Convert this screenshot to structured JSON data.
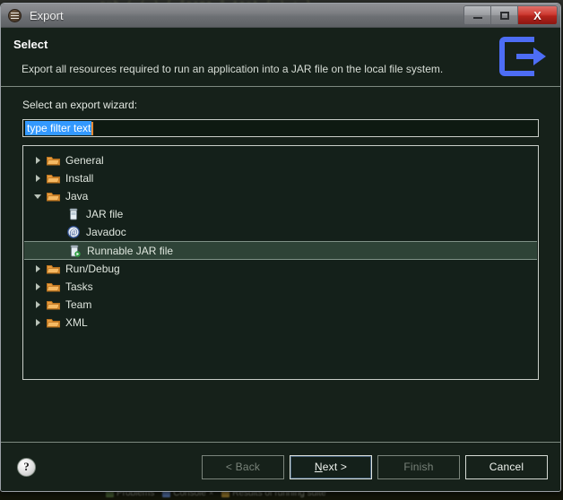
{
  "window": {
    "title": "Export",
    "icon": "eclipse-export-icon",
    "controls": {
      "minimize": "minimize-icon",
      "maximize": "maximize-icon",
      "close": "X"
    }
  },
  "header": {
    "title": "Select",
    "description": "Export all resources required to run an application into a JAR file on the local file system.",
    "icon": "export-arrow-icon",
    "icon_color": "#4d6df5"
  },
  "body": {
    "wizard_label": "Select an export wizard:",
    "filter": {
      "value": "type filter text",
      "placeholder": "type filter text",
      "selected": true
    },
    "tree": [
      {
        "label": "General",
        "depth": 0,
        "state": "collapsed",
        "icon": "folder-icon",
        "selected": false
      },
      {
        "label": "Install",
        "depth": 0,
        "state": "collapsed",
        "icon": "folder-icon",
        "selected": false
      },
      {
        "label": "Java",
        "depth": 0,
        "state": "expanded",
        "icon": "folder-icon",
        "selected": false
      },
      {
        "label": "JAR file",
        "depth": 1,
        "state": "leaf",
        "icon": "jar-file-icon",
        "selected": false
      },
      {
        "label": "Javadoc",
        "depth": 1,
        "state": "leaf",
        "icon": "javadoc-icon",
        "selected": false
      },
      {
        "label": "Runnable JAR file",
        "depth": 1,
        "state": "leaf",
        "icon": "runnable-jar-icon",
        "selected": true
      },
      {
        "label": "Run/Debug",
        "depth": 0,
        "state": "collapsed",
        "icon": "folder-icon",
        "selected": false
      },
      {
        "label": "Tasks",
        "depth": 0,
        "state": "collapsed",
        "icon": "folder-icon",
        "selected": false
      },
      {
        "label": "Team",
        "depth": 0,
        "state": "collapsed",
        "icon": "folder-icon",
        "selected": false
      },
      {
        "label": "XML",
        "depth": 0,
        "state": "collapsed",
        "icon": "folder-icon",
        "selected": false
      }
    ]
  },
  "footer": {
    "help_icon": "question-mark-icon",
    "help_glyph": "?",
    "buttons": [
      {
        "label": "< Back",
        "state": "disabled"
      },
      {
        "label": "Next >",
        "state": "default",
        "mnemonic": "N"
      },
      {
        "label": "Finish",
        "state": "disabled"
      },
      {
        "label": "Cancel",
        "state": "enabled"
      }
    ]
  },
  "background": {
    "code_strip": "pub  ( ( ) [ \"name_\"  text [ ) ; }",
    "tabs": [
      {
        "label": "Problems",
        "icon": "problems-icon"
      },
      {
        "label": "Console",
        "icon": "console-icon",
        "close": "×"
      },
      {
        "label": "Results of running suite",
        "icon": "results-icon"
      }
    ]
  }
}
